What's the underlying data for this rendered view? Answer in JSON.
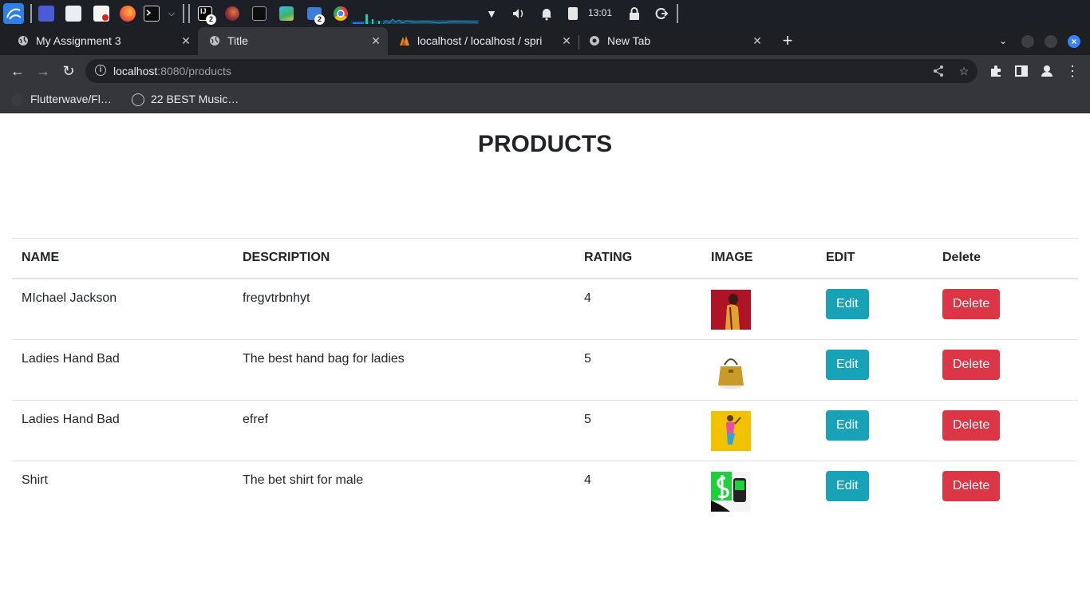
{
  "taskbar": {
    "workspace_badges": [
      "2",
      "2"
    ],
    "clock": "13:01",
    "icons": [
      "kali-menu-icon",
      "workspace-icon",
      "file-manager-icon",
      "text-editor-icon",
      "firefox-icon",
      "terminal-icon",
      "dropdown-icon",
      "intellij-icon",
      "firefox-window-icon",
      "terminal-window-icon",
      "image-viewer-icon",
      "files-window-icon",
      "chrome-icon",
      "network-icon",
      "volume-icon",
      "notification-icon",
      "battery-icon",
      "lock-icon",
      "logout-icon"
    ]
  },
  "browser": {
    "tabs": [
      {
        "title": "My Assignment 3",
        "icon": "globe-icon",
        "active": false
      },
      {
        "title": "Title",
        "icon": "globe-icon",
        "active": true
      },
      {
        "title": "localhost / localhost / spri",
        "icon": "phpmyadmin-icon",
        "active": false
      },
      {
        "title": "New Tab",
        "icon": "chrome-icon",
        "active": false
      }
    ],
    "new_tab_label": "+",
    "url_host": "localhost",
    "url_rest": ":8080/products",
    "bookmarks": [
      {
        "label": "Flutterwave/Fl…",
        "icon": "github-icon"
      },
      {
        "label": "22 BEST Music…",
        "icon": "site-icon"
      }
    ]
  },
  "page": {
    "title": "PRODUCTS",
    "columns": [
      "NAME",
      "DESCRIPTION",
      "RATING",
      "IMAGE",
      "EDIT",
      "Delete"
    ],
    "rows": [
      {
        "name": "MIchael Jackson",
        "description": "fregvtrbnhyt",
        "rating": "4",
        "image": "product-photo-performer",
        "edit": "Edit",
        "delete": "Delete"
      },
      {
        "name": "Ladies Hand Bad",
        "description": "The best hand bag for ladies",
        "rating": "5",
        "image": "product-photo-handbag",
        "edit": "Edit",
        "delete": "Delete"
      },
      {
        "name": "Ladies Hand Bad",
        "description": "efref",
        "rating": "5",
        "image": "product-photo-dancer",
        "edit": "Edit",
        "delete": "Delete"
      },
      {
        "name": "Shirt",
        "description": "The bet shirt for male",
        "rating": "4",
        "image": "product-photo-cashapp",
        "edit": "Edit",
        "delete": "Delete"
      }
    ]
  },
  "colors": {
    "edit_button": "#17a2b8",
    "delete_button": "#dc3545",
    "browser_chrome": "#35363a",
    "taskbar": "#1c1f26"
  }
}
